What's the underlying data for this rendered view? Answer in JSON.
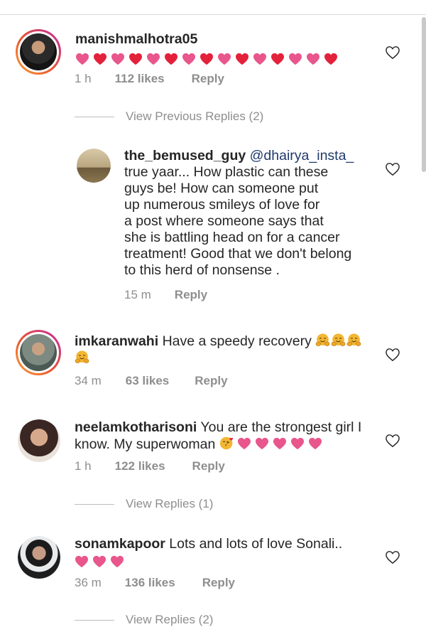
{
  "comments": [
    {
      "username": "manishmalhotra05",
      "text": "",
      "emojis": [
        "heart-pink",
        "heart-red",
        "heart-pink",
        "heart-red",
        "heart-pink",
        "heart-red",
        "heart-pink",
        "heart-red",
        "heart-pink",
        "heart-red",
        "heart-pink",
        "heart-red",
        "heart-pink",
        "heart-pink",
        "heart-red"
      ],
      "time": "1 h",
      "likes": "112 likes",
      "reply": "Reply"
    },
    {
      "username": "the_bemused_guy",
      "mention": "@dhairya_insta_",
      "text_lines": [
        "true yaar... How plastic can these",
        "guys be! How can someone put",
        "up numerous smileys of love for",
        "a post where someone says that",
        "she is battling head on for a cancer",
        "treatment! Good that we don't belong",
        "to this herd of nonsense ."
      ],
      "time": "15 m",
      "reply": "Reply"
    },
    {
      "username": "imkaranwahi",
      "text": "Have a speedy recovery",
      "emojis": [
        "hug",
        "hug",
        "hug",
        "hug"
      ],
      "time": "34 m",
      "likes": "63 likes",
      "reply": "Reply"
    },
    {
      "username": "neelamkotharisoni",
      "text": "You are the strongest girl I",
      "text_line2": "know. My superwoman",
      "emojis": [
        "kiss",
        "heart-pink",
        "heart-pink",
        "heart-pink",
        "heart-pink",
        "heart-pink"
      ],
      "time": "1 h",
      "likes": "122 likes",
      "reply": "Reply"
    },
    {
      "username": "sonamkapoor",
      "text": "Lots and lots of love Sonali..",
      "emojis": [
        "heart-pink",
        "heart-pink",
        "heart-pink"
      ],
      "time": "36 m",
      "likes": "136 likes",
      "reply": "Reply"
    }
  ],
  "view_previous_replies": "View Previous Replies (2)",
  "view_replies_1": "View Replies (1)",
  "view_replies_2": "View Replies (2)",
  "colors": {
    "heart_pink": "#e8568c",
    "heart_red": "#e4213b",
    "secondary_text": "#8e8e8e",
    "mention": "#1f3a6b",
    "hug_emoji": "#f2b632"
  }
}
